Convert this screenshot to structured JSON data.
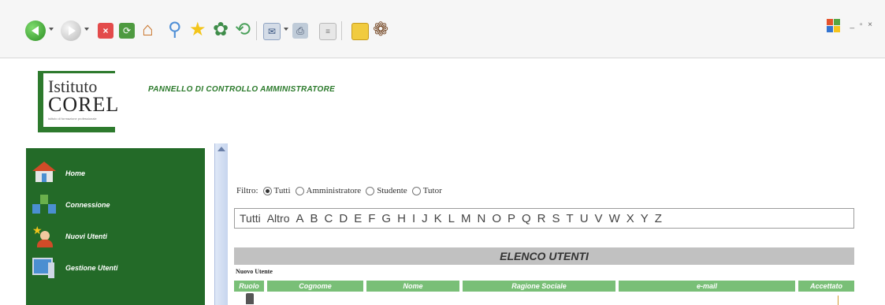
{
  "window": {
    "controls": "_ ▫ ×"
  },
  "toolbar": {
    "icons": [
      "back-icon",
      "forward-icon",
      "stop-icon",
      "refresh-icon",
      "home-icon",
      "search-icon",
      "favorites-icon",
      "media-icon",
      "history-icon",
      "mail-icon",
      "print-icon",
      "edit-icon",
      "folder-icon",
      "settings-icon"
    ]
  },
  "header": {
    "logo_line1": "Istituto",
    "logo_line2": "COREL",
    "logo_tagline": "istituto di formazione professionale",
    "title": "PANNELLO DI CONTROLLO AMMINISTRATORE"
  },
  "sidebar": {
    "items": [
      {
        "label": "Home"
      },
      {
        "label": "Connessione"
      },
      {
        "label": "Nuovi Utenti"
      },
      {
        "label": "Gestione Utenti"
      }
    ]
  },
  "filter": {
    "label": "Filtro:",
    "options": [
      "Tutti",
      "Amministratore",
      "Studente",
      "Tutor"
    ],
    "selected": "Tutti"
  },
  "alphabet": [
    "Tutti",
    "Altro",
    "A",
    "B",
    "C",
    "D",
    "E",
    "F",
    "G",
    "H",
    "I",
    "J",
    "K",
    "L",
    "M",
    "N",
    "O",
    "P",
    "Q",
    "R",
    "S",
    "T",
    "U",
    "V",
    "W",
    "X",
    "Y",
    "Z"
  ],
  "list": {
    "title": "ELENCO UTENTI",
    "new_user_link": "Nuovo Utente",
    "columns": [
      "Ruolo",
      "Cognome",
      "Nome",
      "Ragione Sociale",
      "e-mail",
      "Accettato"
    ]
  },
  "colors": {
    "sidebar_bg": "#236a28",
    "accent_green": "#2b7a2b",
    "column_header": "#79bf77",
    "list_header": "#c1c1c1"
  }
}
